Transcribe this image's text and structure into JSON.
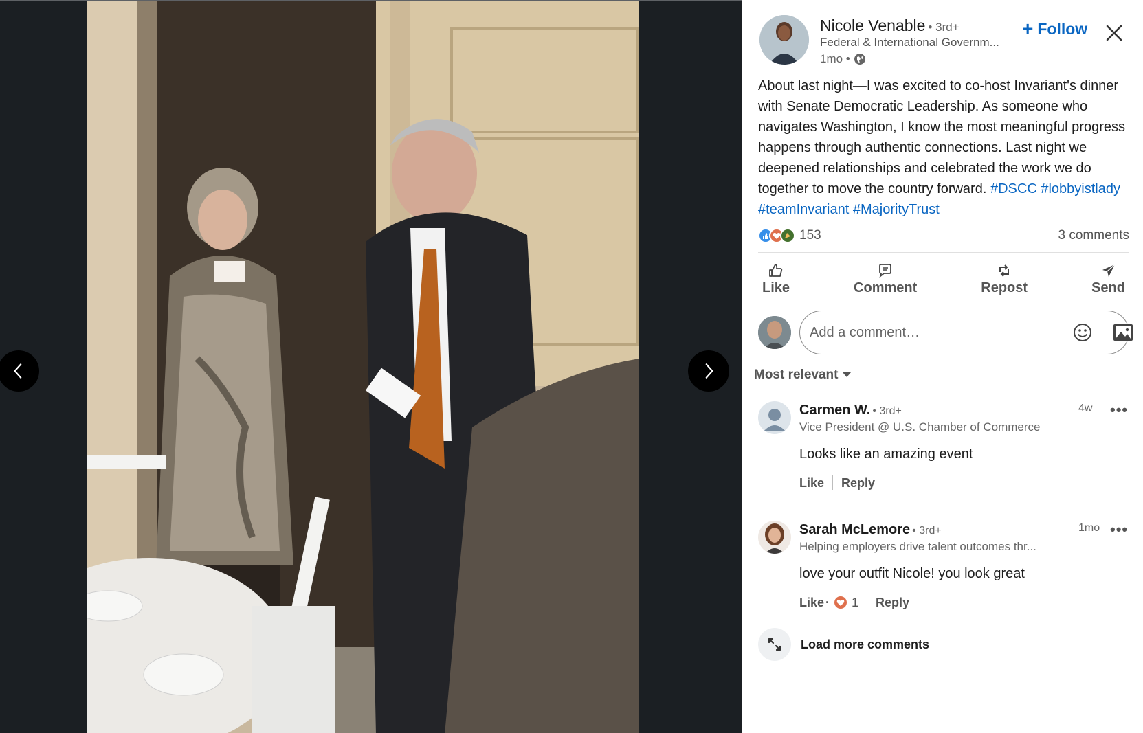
{
  "post": {
    "author": {
      "name": "Nicole Venable",
      "degree": "• 3rd+",
      "headline": "Federal & International Governm...",
      "time": "1mo •"
    },
    "follow_label": "Follow",
    "text": "About last night—I was excited to co-host Invariant's dinner with Senate Democratic Leadership. As someone who navigates Washington, I know the most meaningful progress happens through authentic connections. Last night we deepened relationships and celebrated the work we do together to move the country forward.",
    "hashtags": [
      "#DSCC",
      "#lobbyistlady",
      "#teamInvariant",
      "#MajorityTrust"
    ],
    "reaction_count": "153",
    "comment_count": "3 comments"
  },
  "actions": {
    "like": "Like",
    "comment": "Comment",
    "repost": "Repost",
    "send": "Send"
  },
  "comment_box": {
    "placeholder": "Add a comment…"
  },
  "sort_label": "Most relevant",
  "comments": [
    {
      "name": "Carmen W.",
      "degree": "• 3rd+",
      "headline": "Vice President @ U.S. Chamber of Commerce",
      "time": "4w",
      "body": "Looks like an amazing event",
      "like_label": "Like",
      "reply_label": "Reply"
    },
    {
      "name": "Sarah McLemore",
      "degree": "• 3rd+",
      "headline": "Helping employers drive talent outcomes thr...",
      "time": "1mo",
      "body": "love your outfit Nicole! you look great",
      "like_label": "Like",
      "like_dot": "·",
      "like_count": "1",
      "reply_label": "Reply"
    }
  ],
  "load_more_label": "Load more comments",
  "more_icon_glyph": "•••",
  "icons": [
    "chevron-left-icon",
    "chevron-right-icon",
    "plus-icon",
    "close-icon",
    "globe-icon",
    "like-icon",
    "comment-icon",
    "repost-icon",
    "send-icon",
    "emoji-icon",
    "image-icon",
    "caret-down-icon",
    "expand-icon",
    "heart-icon"
  ],
  "colors": {
    "accent": "#0a66c2",
    "viewer_bg": "#1b1f23",
    "text_secondary": "#666666"
  }
}
